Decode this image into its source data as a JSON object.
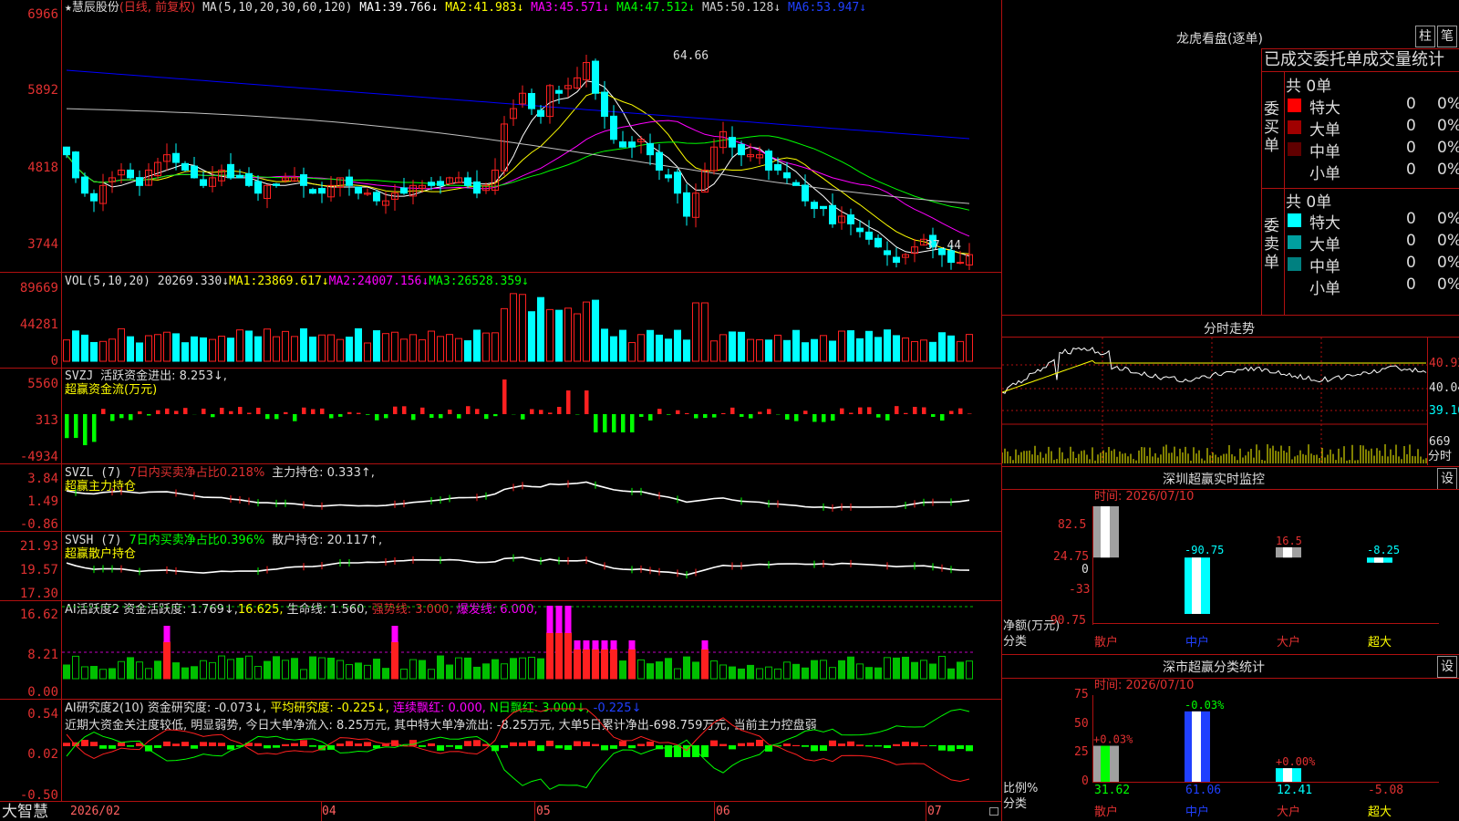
{
  "stock": {
    "star": "★",
    "name": "慧辰股份",
    "mode": "(日线, 前复权)"
  },
  "colors": {
    "up": "#ff2020",
    "down": "#00ffff",
    "ma1": "#ffffff",
    "ma2": "#ffff00",
    "ma3": "#ff00ff",
    "ma4": "#00ff00",
    "ma5": "#c0c0c0",
    "ma6": "#0000ff",
    "axis": "#b01010"
  },
  "price_panel": {
    "ma_label": "MA(5,10,20,30,60,120)",
    "ma": [
      {
        "name": "MA1:",
        "value": "39.766↓"
      },
      {
        "name": "MA2:",
        "value": "41.983↓"
      },
      {
        "name": "MA3:",
        "value": "45.571↓"
      },
      {
        "name": "MA4:",
        "value": "47.512↓"
      },
      {
        "name": "MA5:",
        "value": "50.128↓"
      },
      {
        "name": "MA6:",
        "value": "53.947↓"
      }
    ],
    "y_ticks": [
      "6966",
      "5892",
      "4818",
      "3744"
    ],
    "high_label": "64.66",
    "low_label": "37.44"
  },
  "vol_panel": {
    "label": "VOL(5,10,20)",
    "value": "20269.330↓",
    "ma": [
      {
        "name": "MA1:",
        "value": "23869.617↓"
      },
      {
        "name": "MA2:",
        "value": "24007.156↓"
      },
      {
        "name": "MA3:",
        "value": "26528.359↓"
      }
    ],
    "y_ticks": [
      "89669",
      "44281",
      "0"
    ]
  },
  "svzj_panel": {
    "line1_a": "SVZJ",
    "line1_b": "活跃资金进出: 8.253↓,",
    "line2": "超赢资金流(万元)",
    "y_ticks": [
      "5560",
      "313",
      "-4934"
    ]
  },
  "svzl_panel": {
    "line1_a": "SVZL (7)",
    "line1_b": "7日内买卖净占比0.218%",
    "line1_c": "主力持仓: 0.333↑,",
    "line2": "超赢主力持仓",
    "y_ticks": [
      "3.84",
      "1.49",
      "-0.86"
    ]
  },
  "svsh_panel": {
    "line1_a": "SVSH (7)",
    "line1_b": "7日内买卖净占比0.396%",
    "line1_c": "散户持仓: 20.117↑,",
    "line2": "超赢散户持仓",
    "y_ticks": [
      "21.93",
      "19.57",
      "17.30"
    ]
  },
  "ai_active_panel": {
    "title": "AI活跃度2",
    "a": "资金活跃度: 1.769↓,",
    "b": "16.625,",
    "c": "生命线: 1.560,",
    "d": "强势线: 3.000,",
    "e": "爆发线: 6.000,",
    "y_ticks": [
      "16.62",
      "8.21",
      "0.00"
    ]
  },
  "ai_research_panel": {
    "title": "AI研究度2(10)",
    "a": "资金研究度: -0.073↓,",
    "b": "平均研究度: -0.225↓,",
    "c": "连续飘红: 0.000,",
    "d": "N日飘红: 3.000↓,",
    "e": "-0.225↓",
    "summary": "近期大资金关注度较低, 明显弱势, 今日大单净流入: 8.25万元, 其中特大单净流出: -8.25万元, 大单5日累计净出-698.759万元, 当前主力控盘弱",
    "y_ticks": [
      "0.54",
      "0.02",
      "-0.50"
    ]
  },
  "bottom_axis": {
    "brand": "大智慧",
    "dates": [
      "2026/02",
      "04",
      "05",
      "06",
      "07"
    ]
  },
  "right_panel": {
    "lhb": {
      "title": "龙虎看盘(逐单)",
      "btn1": "柱",
      "btn2": "笔",
      "tabs": "已成交委托单成交量统计"
    },
    "buy": {
      "side": "委买单",
      "total": "共 0单",
      "rows": [
        {
          "label": "特大",
          "count": "0",
          "pct": "0%",
          "color": "#ff0000"
        },
        {
          "label": "大单",
          "count": "0",
          "pct": "0%",
          "color": "#a00000"
        },
        {
          "label": "中单",
          "count": "0",
          "pct": "0%",
          "color": "#600000"
        },
        {
          "label": "小单",
          "count": "0",
          "pct": "0%",
          "color": ""
        }
      ]
    },
    "sell": {
      "side": "委卖单",
      "total": "共 0单",
      "rows": [
        {
          "label": "特大",
          "count": "0",
          "pct": "0%",
          "color": "#00ffff"
        },
        {
          "label": "大单",
          "count": "0",
          "pct": "0%",
          "color": "#00a0a0"
        },
        {
          "label": "中单",
          "count": "0",
          "pct": "0%",
          "color": "#008080"
        },
        {
          "label": "小单",
          "count": "0",
          "pct": "0%",
          "color": ""
        }
      ]
    },
    "intraday": {
      "title": "分时走势",
      "y_right": [
        "40.92",
        "40.04",
        "39.16"
      ],
      "vol_right": "669",
      "vol_unit": "分时"
    },
    "sz_monitor": {
      "title": "深圳超赢实时监控",
      "btn": "设",
      "date": "时间: 2026/07/10",
      "y_ticks": [
        "82.5",
        "24.75",
        "0",
        "-33",
        "-90.75"
      ],
      "unit1": "净额(万元)",
      "unit2": "分类",
      "cats": [
        "散户",
        "中户",
        "大户",
        "超大"
      ],
      "values": [
        "82.5",
        "-90.75",
        "16.5",
        "-8.25"
      ]
    },
    "sz_class": {
      "title": "深市超赢分类统计",
      "btn": "设",
      "date": "时间: 2026/07/10",
      "y_ticks": [
        "75",
        "50",
        "25",
        "0"
      ],
      "unit1": "比例%",
      "unit2": "分类",
      "cats": [
        "散户",
        "中户",
        "大户",
        "超大"
      ],
      "pct_labels": [
        "+0.03%",
        "-0.03%",
        "+0.00%"
      ],
      "values": [
        "31.62",
        "61.06",
        "12.41",
        "-5.08"
      ]
    }
  },
  "chart_data": [
    {
      "type": "candlestick",
      "title": "慧辰股份 (日线, 前复权)",
      "ylim": [
        37.0,
        70.0
      ],
      "high": 64.66,
      "low": 37.44,
      "y_ticks": [
        "6966",
        "5892",
        "4818",
        "3744"
      ],
      "close_series": [
        52,
        49,
        47,
        46,
        48,
        49,
        50,
        49,
        48,
        50,
        51,
        52,
        51,
        50,
        49,
        48,
        49,
        50,
        49,
        49,
        48,
        47,
        48,
        48,
        49,
        49,
        48,
        47,
        47,
        48,
        49,
        48,
        47,
        47,
        46,
        46,
        47,
        47,
        48,
        48,
        48,
        48,
        49,
        49,
        48,
        47,
        48,
        50,
        56,
        58,
        60,
        58,
        57,
        61,
        60,
        61,
        62,
        64,
        60,
        57,
        54,
        53,
        53,
        54,
        52,
        50,
        49,
        47,
        44,
        47,
        50,
        53,
        55,
        53,
        52,
        52,
        52,
        50,
        50,
        49,
        48,
        46,
        45,
        45,
        43,
        44,
        43,
        42,
        41,
        40,
        39,
        38,
        39,
        40,
        41,
        40,
        39,
        38,
        38,
        39
      ],
      "ma": [
        {
          "name": "MA1",
          "value": 39.766
        },
        {
          "name": "MA2",
          "value": 41.983
        },
        {
          "name": "MA3",
          "value": 45.571
        },
        {
          "name": "MA4",
          "value": 47.512
        },
        {
          "name": "MA5",
          "value": 50.128
        },
        {
          "name": "MA6",
          "value": 53.947
        }
      ]
    },
    {
      "type": "bar",
      "title": "VOL(5,10,20)",
      "ylim": [
        0,
        89669
      ],
      "last": 20269.33
    },
    {
      "type": "bar",
      "title": "超赢资金流(万元)",
      "ylim": [
        -4934,
        5560
      ]
    },
    {
      "type": "line",
      "title": "超赢主力持仓",
      "ylim": [
        -0.86,
        3.84
      ]
    },
    {
      "type": "line",
      "title": "超赢散户持仓",
      "ylim": [
        17.3,
        21.93
      ]
    },
    {
      "type": "bar",
      "title": "AI活跃度2",
      "ylim": [
        0,
        16.62
      ]
    },
    {
      "type": "bar",
      "title": "AI研究度2(10)",
      "ylim": [
        -0.5,
        0.54
      ]
    },
    {
      "type": "bar",
      "title": "深圳超赢实时监控",
      "categories": [
        "散户",
        "中户",
        "大户",
        "超大"
      ],
      "values": [
        82.5,
        -90.75,
        16.5,
        -8.25
      ],
      "ylim": [
        -90.75,
        82.5
      ]
    },
    {
      "type": "bar",
      "title": "深市超赢分类统计",
      "categories": [
        "散户",
        "中户",
        "大户",
        "超大"
      ],
      "values": [
        31.62,
        61.06,
        12.41,
        -5.08
      ],
      "ylim": [
        0,
        75
      ]
    }
  ]
}
